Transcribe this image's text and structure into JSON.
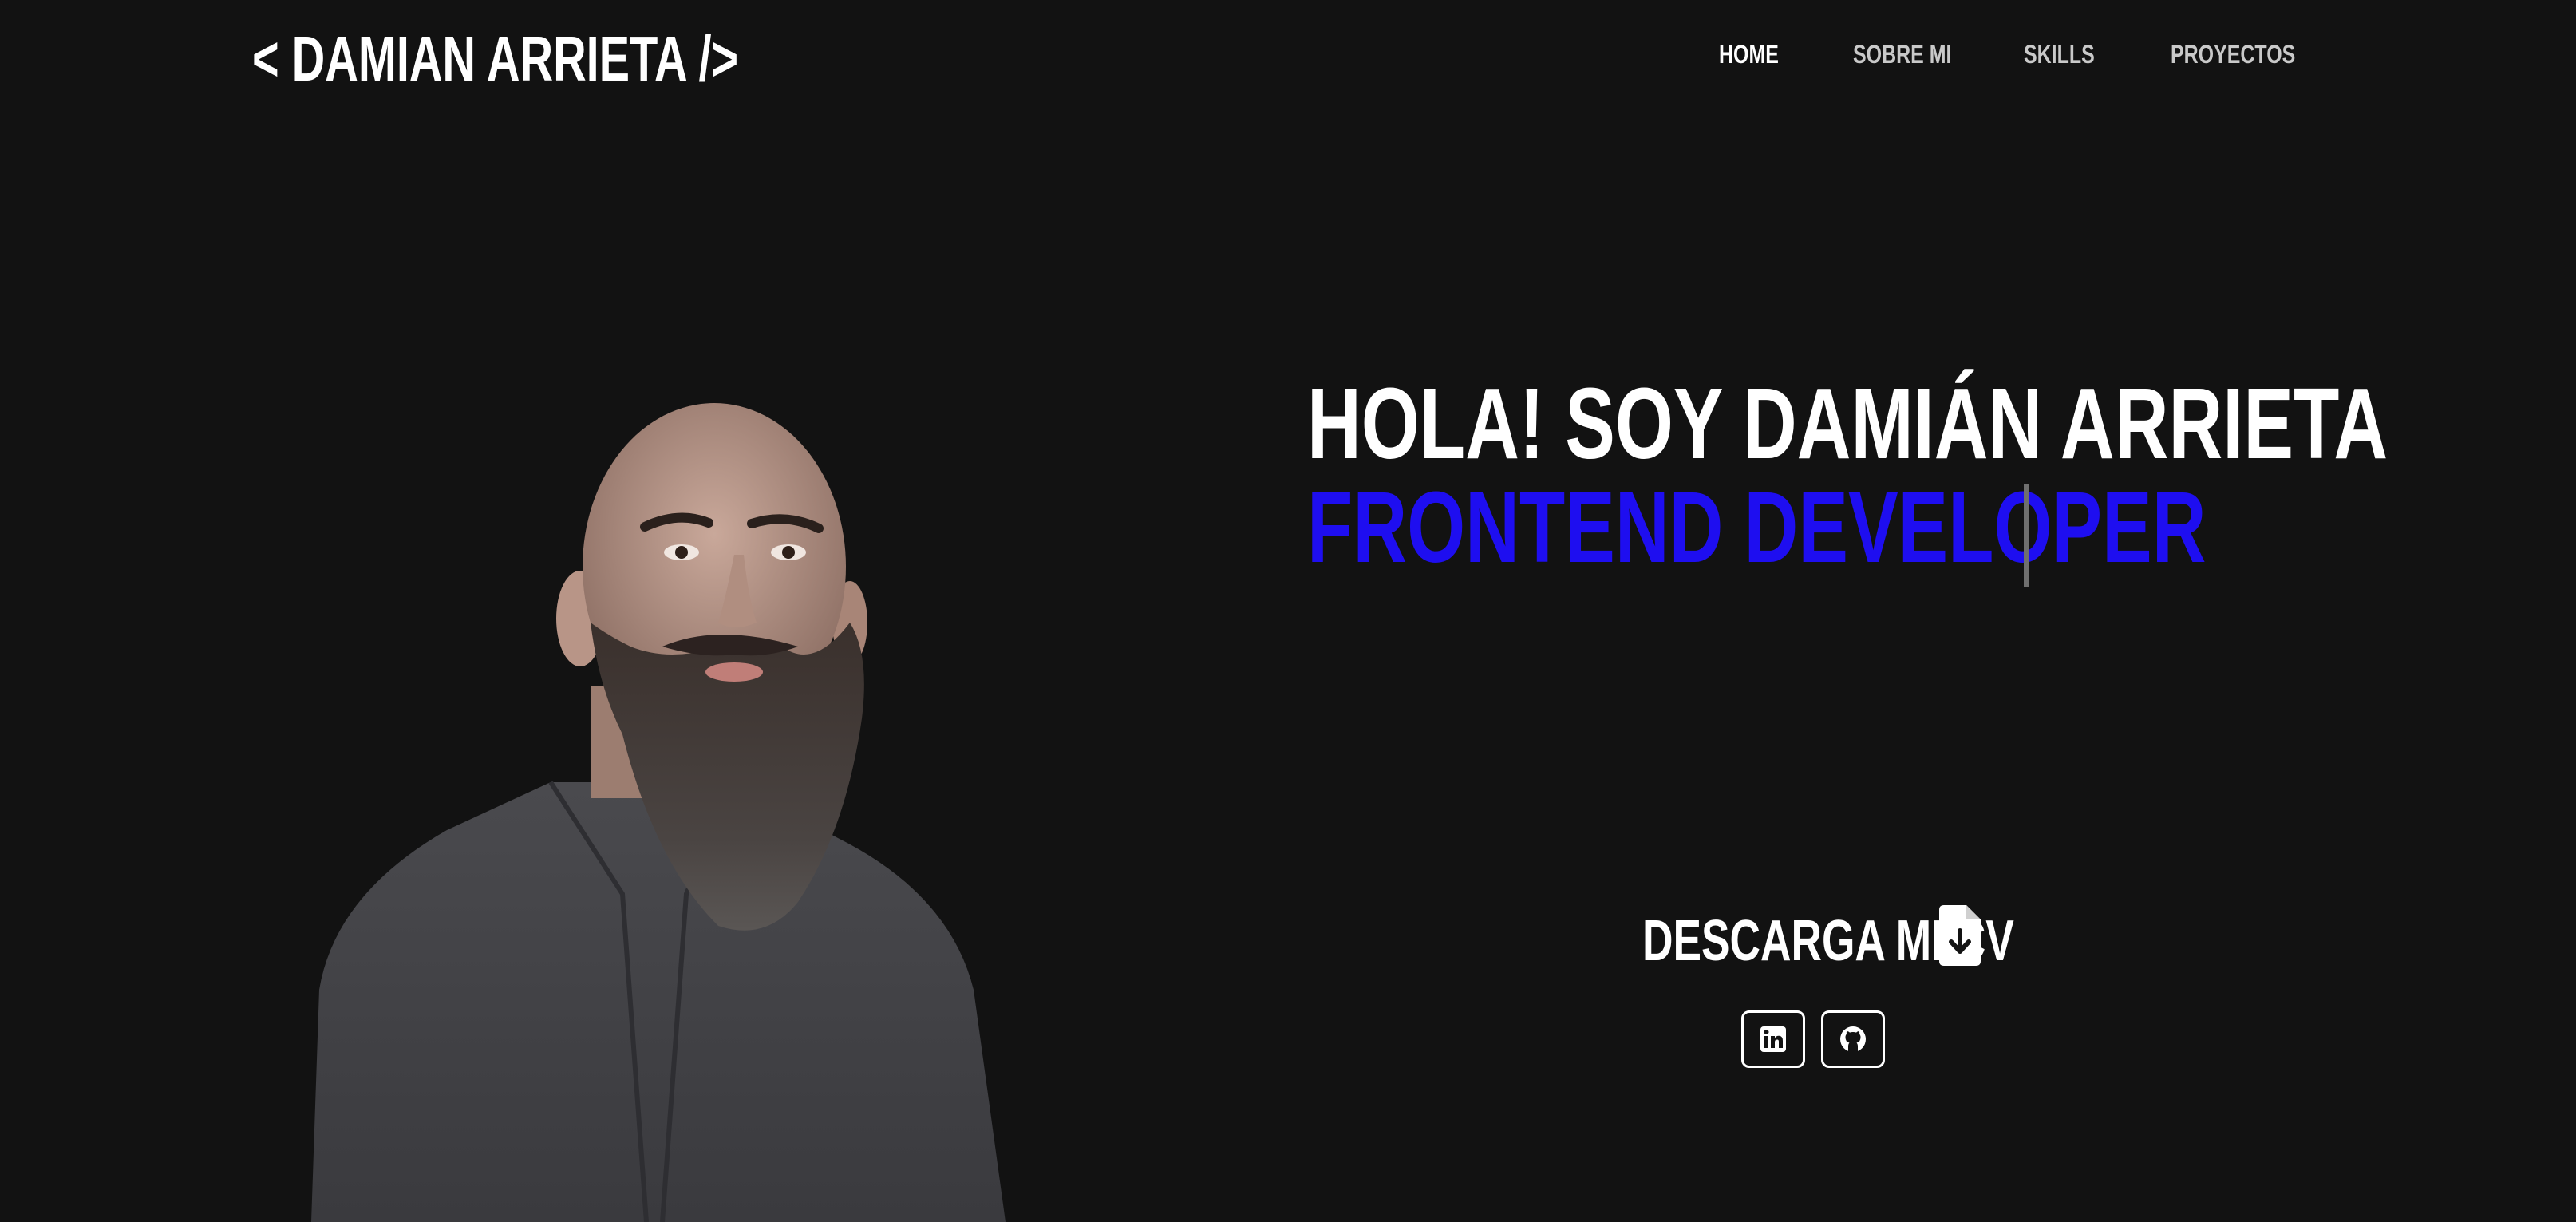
{
  "header": {
    "logo": "< DAMIAN ARRIETA />",
    "nav": [
      {
        "label": "HOME",
        "active": true
      },
      {
        "label": "SOBRE MI",
        "active": false
      },
      {
        "label": "SKILLS",
        "active": false
      },
      {
        "label": "PROYECTOS",
        "active": false
      }
    ]
  },
  "hero": {
    "title": "HOLA! SOY DAMIÁN ARRIETA",
    "subtitle": "FRONTEND DEVELOPER",
    "cv_label": "DESCARGA MI CV"
  },
  "icons": {
    "cv": "file-download-icon",
    "linkedin": "linkedin-icon",
    "github": "github-icon"
  },
  "colors": {
    "background": "#121212",
    "text": "#ffffff",
    "accent": "#1e0ef0",
    "nav_inactive": "#c9c9c9"
  }
}
